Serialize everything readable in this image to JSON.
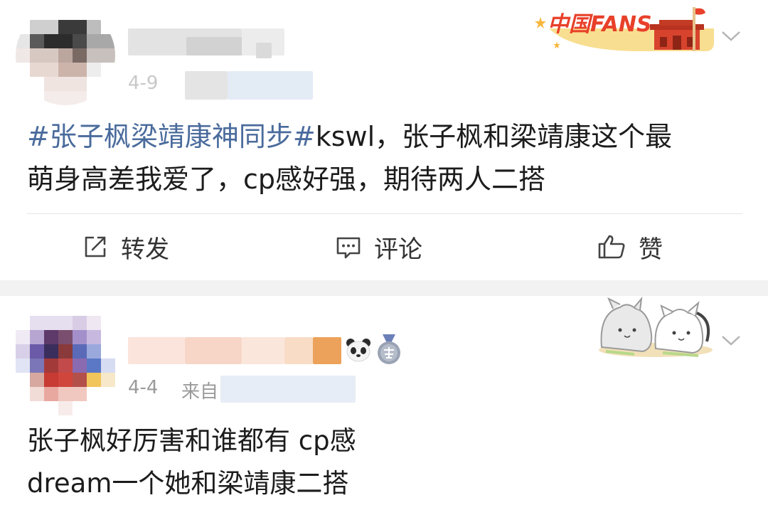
{
  "feed": {
    "posts": [
      {
        "author": {
          "name": "",
          "avatar": "blurred-avatar"
        },
        "meta": {
          "time": "4-9",
          "source": ""
        },
        "badge": {
          "text": "中国FANS",
          "icon": "tiananmen-icon"
        },
        "content": {
          "hashtag": "#张子枫梁靖康神同步#",
          "line1_rest": "kswl，张子枫和梁靖康这个最",
          "line2": "萌身高差我爱了，cp感好强，期待两人二搭"
        },
        "actions": {
          "repost_label": "转发",
          "comment_label": "评论",
          "like_label": "赞"
        }
      },
      {
        "author": {
          "name": "",
          "avatar": "blurred-avatar"
        },
        "meta": {
          "time": "4-4",
          "source_prefix": "来自"
        },
        "badges": [
          "panda-icon",
          "medal-icon"
        ],
        "sticker": "cartoon-cats-sticker",
        "content": {
          "line1": "张子枫好厉害和谁都有 cp感",
          "line2": "dream一个她和梁靖康二搭"
        }
      }
    ]
  },
  "colors": {
    "hashtag": "#4a6b9c",
    "text": "#1c1c1c",
    "meta": "#9a9a9a",
    "separator": "#f2f2f2",
    "badge_red": "#e8402a",
    "badge_gold": "#f6b73c"
  }
}
